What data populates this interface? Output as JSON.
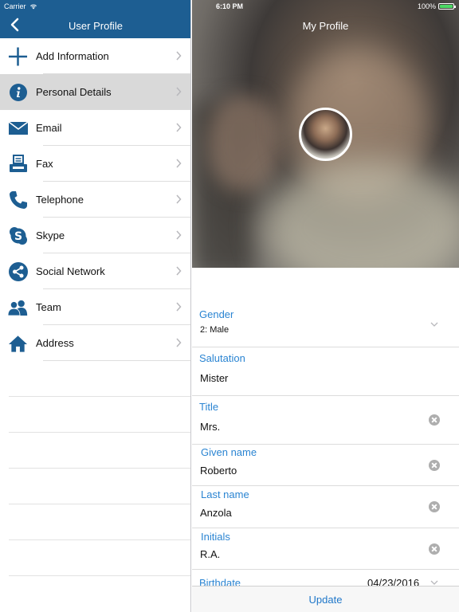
{
  "status": {
    "carrier": "Carrier",
    "time": "6:10 PM",
    "battery": "100%"
  },
  "left": {
    "title": "User Profile",
    "items": [
      {
        "label": "Add Information",
        "icon": "plus-icon",
        "selected": false
      },
      {
        "label": "Personal Details",
        "icon": "info-icon",
        "selected": true
      },
      {
        "label": "Email",
        "icon": "envelope-icon",
        "selected": false
      },
      {
        "label": "Fax",
        "icon": "fax-icon",
        "selected": false
      },
      {
        "label": "Telephone",
        "icon": "phone-icon",
        "selected": false
      },
      {
        "label": "Skype",
        "icon": "skype-icon",
        "selected": false
      },
      {
        "label": "Social Network",
        "icon": "share-icon",
        "selected": false
      },
      {
        "label": "Team",
        "icon": "team-icon",
        "selected": false
      },
      {
        "label": "Address",
        "icon": "home-icon",
        "selected": false
      }
    ]
  },
  "right": {
    "title": "My Profile",
    "fields": {
      "gender": {
        "label": "Gender",
        "value": "2: Male"
      },
      "salutation": {
        "label": "Salutation",
        "value": "Mister"
      },
      "title": {
        "label": "Title",
        "value": "Mrs."
      },
      "given_name": {
        "label": "Given name",
        "value": "Roberto"
      },
      "last_name": {
        "label": "Last name",
        "value": "Anzola"
      },
      "initials": {
        "label": "Initials",
        "value": "R.A."
      },
      "birthdate": {
        "label": "Birthdate",
        "value": "04/23/2016"
      }
    },
    "update_label": "Update"
  },
  "colors": {
    "nav": "#1d5e92",
    "icon": "#1d5e92",
    "accent": "#2a84d2"
  }
}
